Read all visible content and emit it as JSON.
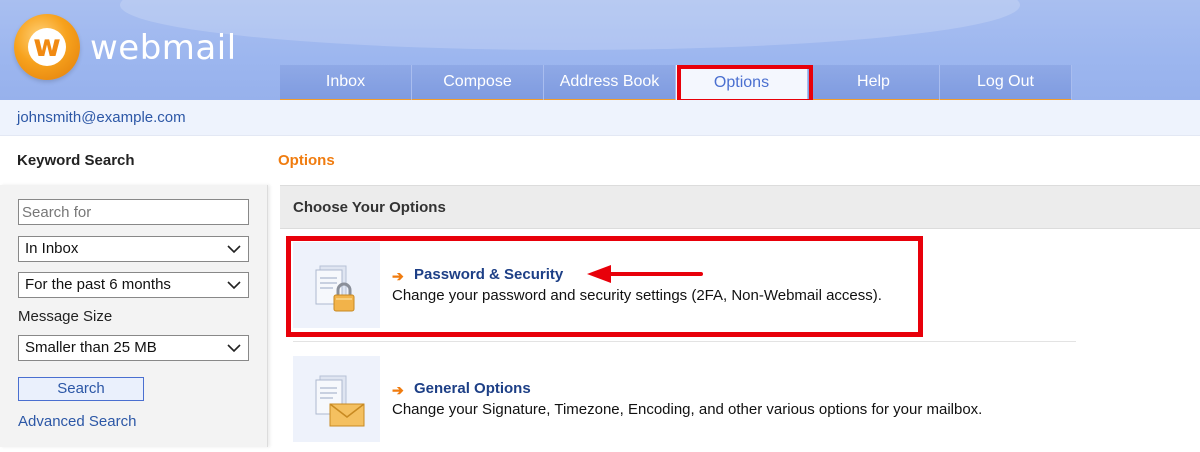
{
  "header": {
    "brand": "webmail",
    "logo_letter": "w"
  },
  "nav": {
    "items": [
      {
        "label": "Inbox"
      },
      {
        "label": "Compose"
      },
      {
        "label": "Address Book"
      },
      {
        "label": "Options",
        "active": true
      },
      {
        "label": "Help"
      },
      {
        "label": "Log Out"
      }
    ]
  },
  "account": {
    "email": "johnsmith@example.com"
  },
  "sidebar": {
    "title": "Keyword Search",
    "search_placeholder": "Search for",
    "folder_select": "In Inbox",
    "date_select": "For the past 6 months",
    "size_label": "Message Size",
    "size_select": "Smaller than 25 MB",
    "search_button": "Search",
    "advanced_link": "Advanced Search"
  },
  "main": {
    "title": "Options",
    "panel_header": "Choose Your Options",
    "options": [
      {
        "title": "Password & Security",
        "description": "Change your password and security settings (2FA, Non-Webmail access).",
        "icon": "document-lock-icon"
      },
      {
        "title": "General Options",
        "description": "Change your Signature, Timezone, Encoding, and other various options for your mailbox.",
        "icon": "document-envelope-icon"
      }
    ]
  },
  "colors": {
    "accent_orange": "#f07c0f",
    "link_blue": "#2c57a6",
    "highlight_red": "#e8000a",
    "nav_blue": "#8fa9e6"
  }
}
